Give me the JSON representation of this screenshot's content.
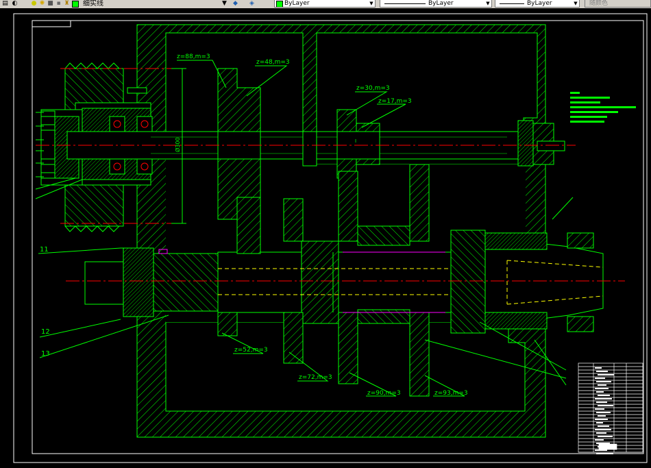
{
  "toolbar": {
    "layer_name": "细实线",
    "color_combo": "ByLayer",
    "linetype_combo": "ByLayer",
    "lineweight_combo": "ByLayer",
    "plotstyle_combo": "随颜色",
    "colors": {
      "layer_swatch": "#00ff00",
      "color_swatch": "#00ff00"
    }
  },
  "drawing": {
    "background": "#000000",
    "line_color": "#00ff00",
    "centerline_color": "#ff0000",
    "hidden_color": "#ffff00",
    "accent_color": "#ff00ff",
    "gear_labels": [
      "z=88,m=3",
      "z=48,m=3",
      "z=30,m=3",
      "z=17,m=3",
      "z=52,m=3",
      "z=72,m=3",
      "z=90,m=3",
      "z=93,m=3"
    ],
    "part_numbers": [
      "11",
      "12",
      "13"
    ],
    "dimension_label": "Ø300",
    "shaft_mark": "I"
  }
}
